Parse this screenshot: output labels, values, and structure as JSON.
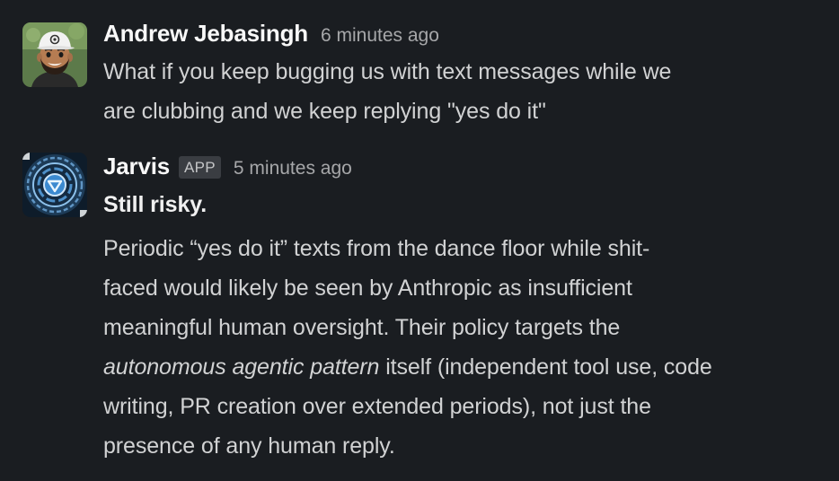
{
  "messages": [
    {
      "sender": "Andrew Jebasingh",
      "timestamp": "6 minutes ago",
      "avatar_icon": "cartoon-man-avatar",
      "lines": [
        "What if you keep bugging us with text messages while we",
        "are clubbing and we keep replying \"yes do it\""
      ]
    },
    {
      "sender": "Jarvis",
      "badge": "APP",
      "timestamp": "5 minutes ago",
      "avatar_icon": "jarvis-hud-avatar",
      "headline": "Still risky.",
      "lines": [
        "Periodic “yes do it” texts from the dance floor while shit-",
        "faced would likely be seen by Anthropic as insufficient",
        "meaningful human oversight. Their policy targets the"
      ],
      "line_italic_part": "autonomous agentic pattern",
      "line_italic_rest": " itself (independent tool use, code",
      "lines_after": [
        "writing, PR creation over extended periods), not just the",
        "presence of any human reply."
      ]
    }
  ],
  "colors": {
    "background": "#1a1d21",
    "text": "#d1d2d3",
    "sender": "#f8f8f8",
    "timestamp": "#a6a7a9",
    "badge_bg": "#3a3d42"
  }
}
